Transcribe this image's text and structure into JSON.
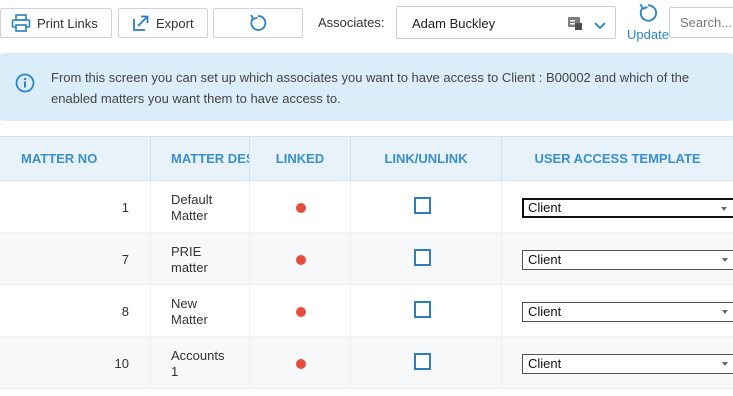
{
  "toolbar": {
    "print_label": "Print Links",
    "export_label": "Export",
    "associates_label": "Associates:",
    "associate_selected": "Adam Buckley",
    "update_label": "Update",
    "search_placeholder": "Search..."
  },
  "banner": {
    "text": "From this screen you can set up which associates you want to have access to Client : B00002 and which of the enabled matters you want them to have access to."
  },
  "table": {
    "headers": [
      "MATTER NO",
      "MATTER DESCRIPTION",
      "LINKED",
      "LINK/UNLINK",
      "USER ACCESS TEMPLATE"
    ],
    "rows": [
      {
        "matter_no": "1",
        "desc_line1": "Default",
        "desc_line2": "Matter",
        "template": "Client"
      },
      {
        "matter_no": "7",
        "desc_line1": "PRIE",
        "desc_line2": "matter",
        "template": "Client"
      },
      {
        "matter_no": "8",
        "desc_line1": "New",
        "desc_line2": "Matter",
        "template": "Client"
      },
      {
        "matter_no": "10",
        "desc_line1": "Accounts",
        "desc_line2": "1",
        "template": "Client"
      }
    ]
  },
  "colors": {
    "accent": "#2a86c8",
    "header_text": "#3a8fcd",
    "banner_bg": "#dbedf9",
    "linked_dot": "#e84c3d"
  },
  "icons": {
    "print": "printer-icon",
    "export": "export-icon",
    "refresh": "refresh-icon",
    "update": "refresh-icon",
    "info": "info-icon",
    "dropdown": "chevron-down-icon"
  }
}
